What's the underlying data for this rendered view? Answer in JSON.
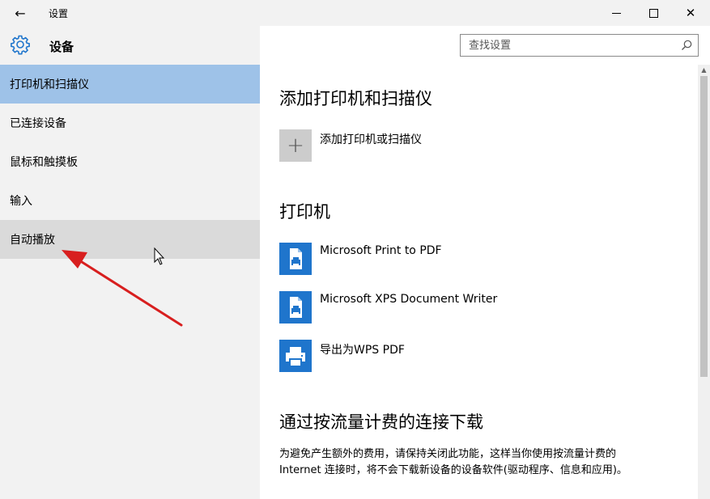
{
  "window": {
    "back_glyph": "←",
    "title": "设置",
    "minimize_icon": "minimize-icon",
    "maximize_icon": "maximize-icon",
    "close_glyph": "✕"
  },
  "sidebar": {
    "header_icon": "gear-icon",
    "header_title": "设备",
    "items": [
      {
        "label": "打印机和扫描仪",
        "state": "selected"
      },
      {
        "label": "已连接设备",
        "state": "normal"
      },
      {
        "label": "鼠标和触摸板",
        "state": "normal"
      },
      {
        "label": "输入",
        "state": "normal"
      },
      {
        "label": "自动播放",
        "state": "hover"
      }
    ]
  },
  "search": {
    "placeholder": "查找设置",
    "icon": "search-icon"
  },
  "main": {
    "section_add": {
      "heading": "添加打印机和扫描仪",
      "add_label": "添加打印机或扫描仪",
      "add_glyph": "+"
    },
    "section_printers": {
      "heading": "打印机",
      "printers": [
        {
          "name": "Microsoft Print to PDF",
          "icon": "printer-document-icon"
        },
        {
          "name": "Microsoft XPS Document Writer",
          "icon": "printer-document-icon"
        },
        {
          "name": "导出为WPS PDF",
          "icon": "printer-icon"
        }
      ]
    },
    "section_metered": {
      "heading": "通过按流量计费的连接下载",
      "description": "为避免产生额外的费用，请保持关闭此功能，这样当你使用按流量计费的 Internet 连接时，将不会下载新设备的设备软件(驱动程序、信息和应用)。"
    }
  },
  "colors": {
    "selected_bg": "#9ec2e8",
    "hover_bg": "#dadada",
    "sidebar_bg": "#f2f2f2",
    "printer_tile": "#1f75cc",
    "arrow": "#e02020"
  }
}
